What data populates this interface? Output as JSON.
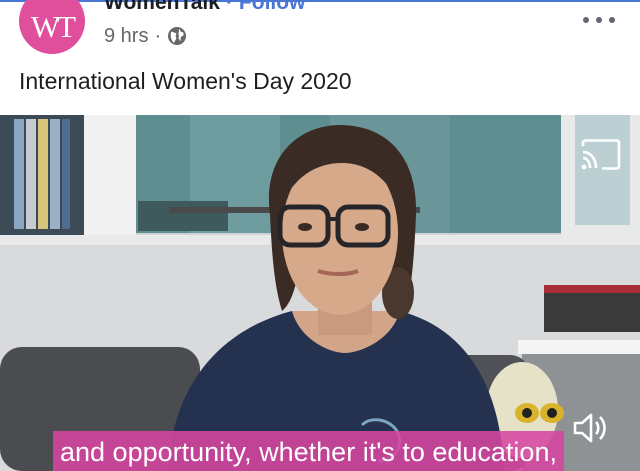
{
  "post": {
    "author": "WomenTalk",
    "separator": "·",
    "follow_label": "Follow",
    "time": "9 hrs",
    "time_separator": "·",
    "privacy_icon": "globe-icon",
    "more_icon": "more-options-icon",
    "avatar_logo": "WT",
    "text": "International Women's Day 2020"
  },
  "video": {
    "caption": "and opportunity, whether it's to education,",
    "cast_icon": "cast-icon",
    "volume_icon": "volume-icon"
  },
  "colors": {
    "brand_pink": "#e04f9b",
    "link_blue": "#4a76d6",
    "caption_bg": "#d646a0"
  }
}
